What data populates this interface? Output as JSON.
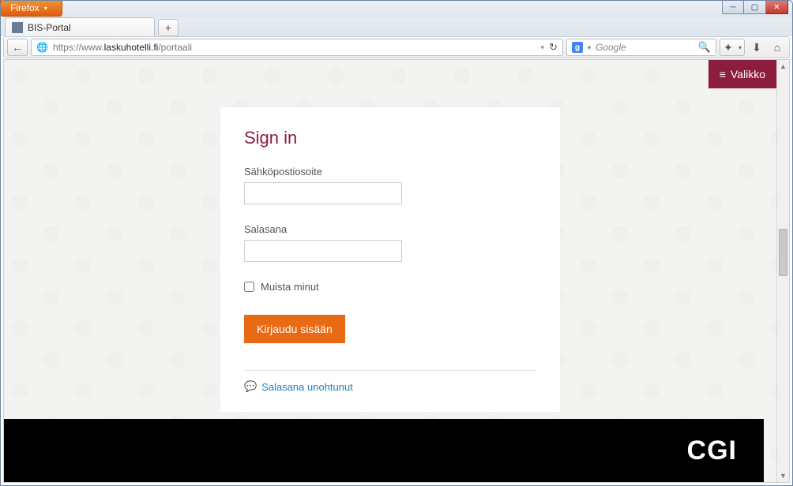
{
  "browser": {
    "app_button": "Firefox",
    "window_title_hint": "",
    "tab": {
      "title": "BIS-Portal"
    },
    "url_host": "https://www.",
    "url_domain": "laskuhotelli.fi",
    "url_path": "/portaali",
    "search_engine_letter": "g",
    "search_placeholder": "Google"
  },
  "page": {
    "menu_button": "Valikko",
    "login": {
      "heading": "Sign in",
      "email_label": "Sähköpostiosoite",
      "email_value": "",
      "password_label": "Salasana",
      "password_value": "",
      "remember_label": "Muista minut",
      "submit_label": "Kirjaudu sisään",
      "forgot_label": "Salasana unohtunut"
    },
    "footer_logo": "CGI"
  }
}
